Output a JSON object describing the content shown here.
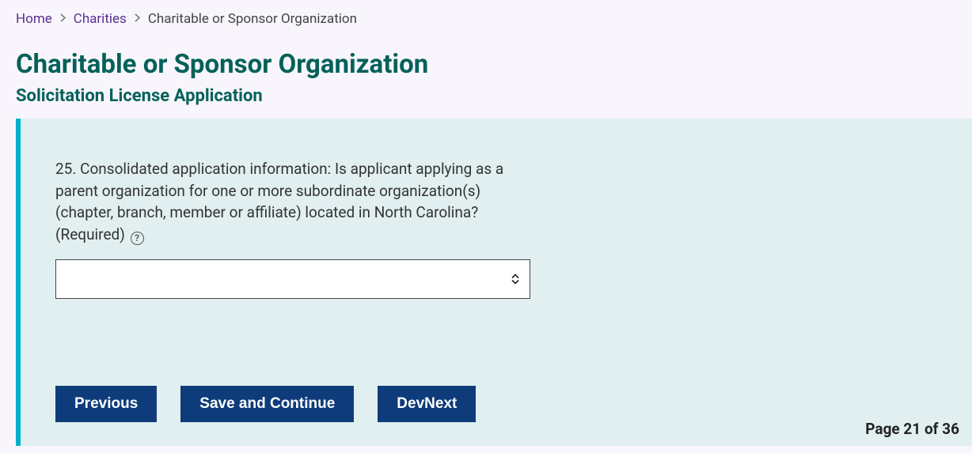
{
  "breadcrumb": {
    "home": "Home",
    "charities": "Charities",
    "current": "Charitable or Sponsor Organization"
  },
  "header": {
    "title": "Charitable or Sponsor Organization",
    "subtitle": "Solicitation License Application"
  },
  "question": {
    "text": "25. Consolidated application information: Is applicant applying as a parent organization for one or more subordinate organization(s) (chapter, branch, member or affiliate) located in North Carolina? (Required)",
    "help_symbol": "?",
    "selected_value": ""
  },
  "buttons": {
    "previous": "Previous",
    "save_continue": "Save and Continue",
    "devnext": "DevNext"
  },
  "pager": {
    "text": "Page 21 of 36"
  }
}
